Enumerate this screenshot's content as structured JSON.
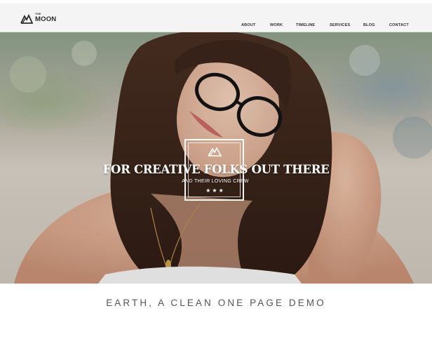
{
  "brand": {
    "small_text": "THE",
    "name": "MOON",
    "logo_icon": "mountain-icon"
  },
  "nav": {
    "items": [
      {
        "label": "ABOUT"
      },
      {
        "label": "WORK"
      },
      {
        "label": "TIMELINE"
      },
      {
        "label": "SERVICES"
      },
      {
        "label": "BLOG"
      },
      {
        "label": "CONTACT"
      }
    ]
  },
  "hero": {
    "title": "FOR CREATIVE FOLKS OUT THERE",
    "subtitle": "AND THEIR LOVING CREW",
    "stars": "★★★",
    "badge_icon": "mountain-icon"
  },
  "tagline": "EARTH, A CLEAN ONE PAGE DEMO",
  "colors": {
    "header_bg": "#f4f4f4",
    "text_dark": "#2d2d2d",
    "tagline": "#555555",
    "hero_text": "#ffffff"
  }
}
